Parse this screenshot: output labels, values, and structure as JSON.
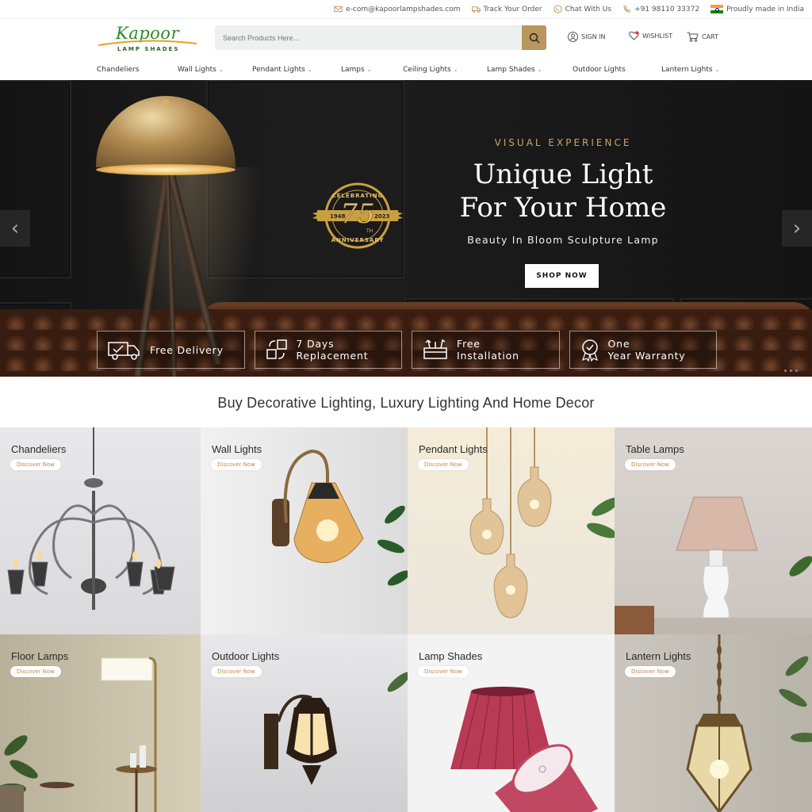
{
  "topbar": {
    "email": "e-com@kapoorlampshades.com",
    "track": "Track Your Order",
    "chat": "Chat With Us",
    "phone": "+91 98110 33372",
    "made": "Proudly made in India"
  },
  "header": {
    "brand": "Kapoor",
    "brand_sub": "LAMP SHADES",
    "search_placeholder": "Search Products Here...",
    "signin": "SIGN IN",
    "wishlist": "WISHLIST",
    "cart": "CART"
  },
  "nav": [
    {
      "label": "Chandeliers",
      "dropdown": false
    },
    {
      "label": "Wall Lights",
      "dropdown": true
    },
    {
      "label": "Pendant Lights",
      "dropdown": true
    },
    {
      "label": "Lamps",
      "dropdown": true
    },
    {
      "label": "Ceiling Lights",
      "dropdown": true
    },
    {
      "label": "Lamp Shades",
      "dropdown": true
    },
    {
      "label": "Outdoor Lights",
      "dropdown": false
    },
    {
      "label": "Lantern Lights",
      "dropdown": true
    }
  ],
  "hero": {
    "eyebrow": "VISUAL EXPERIENCE",
    "title_line1": "Unique Light",
    "title_line2": "For Your Home",
    "subtitle": "Beauty In Bloom Sculpture Lamp",
    "cta": "SHOP NOW",
    "badge": {
      "top": "CELEBRATING",
      "number": "75",
      "suffix": "TH",
      "year_start": "1948",
      "year_end": "2023",
      "bottom": "ANNIVERSARY"
    }
  },
  "features": [
    {
      "line1": "Free Delivery",
      "line2": "",
      "icon": "truck-icon"
    },
    {
      "line1": "7 Days",
      "line2": "Replacement",
      "icon": "replace-icon"
    },
    {
      "line1": "Free",
      "line2": "Installation",
      "icon": "tools-icon"
    },
    {
      "line1": "One",
      "line2": "Year Warranty",
      "icon": "warranty-icon"
    }
  ],
  "section_title": "Buy Decorative Lighting, Luxury Lighting And Home Decor",
  "categories": [
    {
      "name": "Chandeliers",
      "cta": "Discover Now"
    },
    {
      "name": "Wall Lights",
      "cta": "Discover Now"
    },
    {
      "name": "Pendant Lights",
      "cta": "Discover Now"
    },
    {
      "name": "Table Lamps",
      "cta": "Discover Now"
    },
    {
      "name": "Floor Lamps",
      "cta": "Discover Now"
    },
    {
      "name": "Outdoor Lights",
      "cta": "Discover Now"
    },
    {
      "name": "Lamp Shades",
      "cta": "Discover Now"
    },
    {
      "name": "Lantern Lights",
      "cta": "Discover Now"
    }
  ],
  "colors": {
    "accent": "#b9965b",
    "brand_green": "#2a8a2a",
    "hero_gold": "#c8a46a",
    "cta_orange": "#c8874a"
  }
}
